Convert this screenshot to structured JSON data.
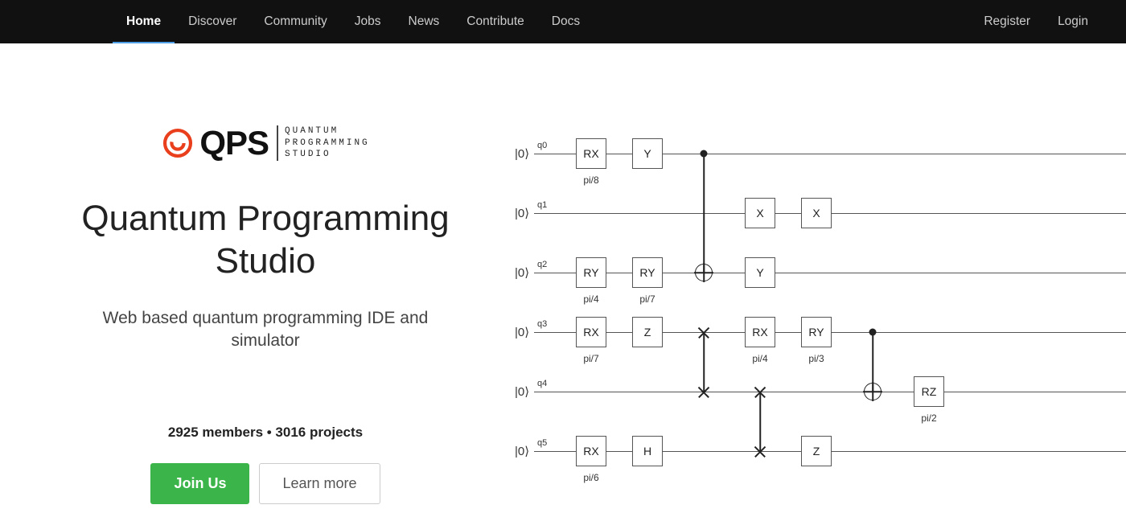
{
  "nav": {
    "left": [
      "Home",
      "Discover",
      "Community",
      "Jobs",
      "News",
      "Contribute",
      "Docs"
    ],
    "activeIndex": 0,
    "right": [
      "Register",
      "Login"
    ]
  },
  "logo": {
    "abbr": "QPS",
    "tag1": "QUANTUM",
    "tag2": "PROGRAMMING",
    "tag3": "STUDIO"
  },
  "hero": {
    "title": "Quantum Programming Studio",
    "subtitle": "Web based quantum programming IDE and simulator",
    "stats": "2925 members • 3016 projects",
    "join": "Join Us",
    "learn": "Learn more"
  },
  "circuit": {
    "ket": "|0⟩",
    "rows": [
      "q0",
      "q1",
      "q2",
      "q3",
      "q4",
      "q5"
    ],
    "cols": [
      95,
      165,
      235,
      305,
      375,
      445,
      515
    ],
    "gates": [
      {
        "row": 0,
        "col": 0,
        "label": "RX",
        "sub": "pi/8"
      },
      {
        "row": 0,
        "col": 1,
        "label": "Y"
      },
      {
        "row": 1,
        "col": 3,
        "label": "X"
      },
      {
        "row": 1,
        "col": 4,
        "label": "X"
      },
      {
        "row": 2,
        "col": 0,
        "label": "RY",
        "sub": "pi/4"
      },
      {
        "row": 2,
        "col": 1,
        "label": "RY",
        "sub": "pi/7"
      },
      {
        "row": 2,
        "col": 3,
        "label": "Y"
      },
      {
        "row": 3,
        "col": 0,
        "label": "RX",
        "sub": "pi/7"
      },
      {
        "row": 3,
        "col": 1,
        "label": "Z"
      },
      {
        "row": 3,
        "col": 3,
        "label": "RX",
        "sub": "pi/4"
      },
      {
        "row": 3,
        "col": 4,
        "label": "RY",
        "sub": "pi/3"
      },
      {
        "row": 4,
        "col": 6,
        "label": "RZ",
        "sub": "pi/2"
      },
      {
        "row": 5,
        "col": 0,
        "label": "RX",
        "sub": "pi/6"
      },
      {
        "row": 5,
        "col": 1,
        "label": "H"
      },
      {
        "row": 5,
        "col": 4,
        "label": "Z"
      }
    ],
    "cnots": [
      {
        "col": 2,
        "ctrl": 0,
        "tgt": 2
      },
      {
        "col": 5,
        "ctrl": 3,
        "tgt": 4
      }
    ],
    "swaps": [
      {
        "col": 2,
        "a": 3,
        "b": 4
      },
      {
        "col": 3,
        "a": 4,
        "b": 5
      }
    ]
  }
}
